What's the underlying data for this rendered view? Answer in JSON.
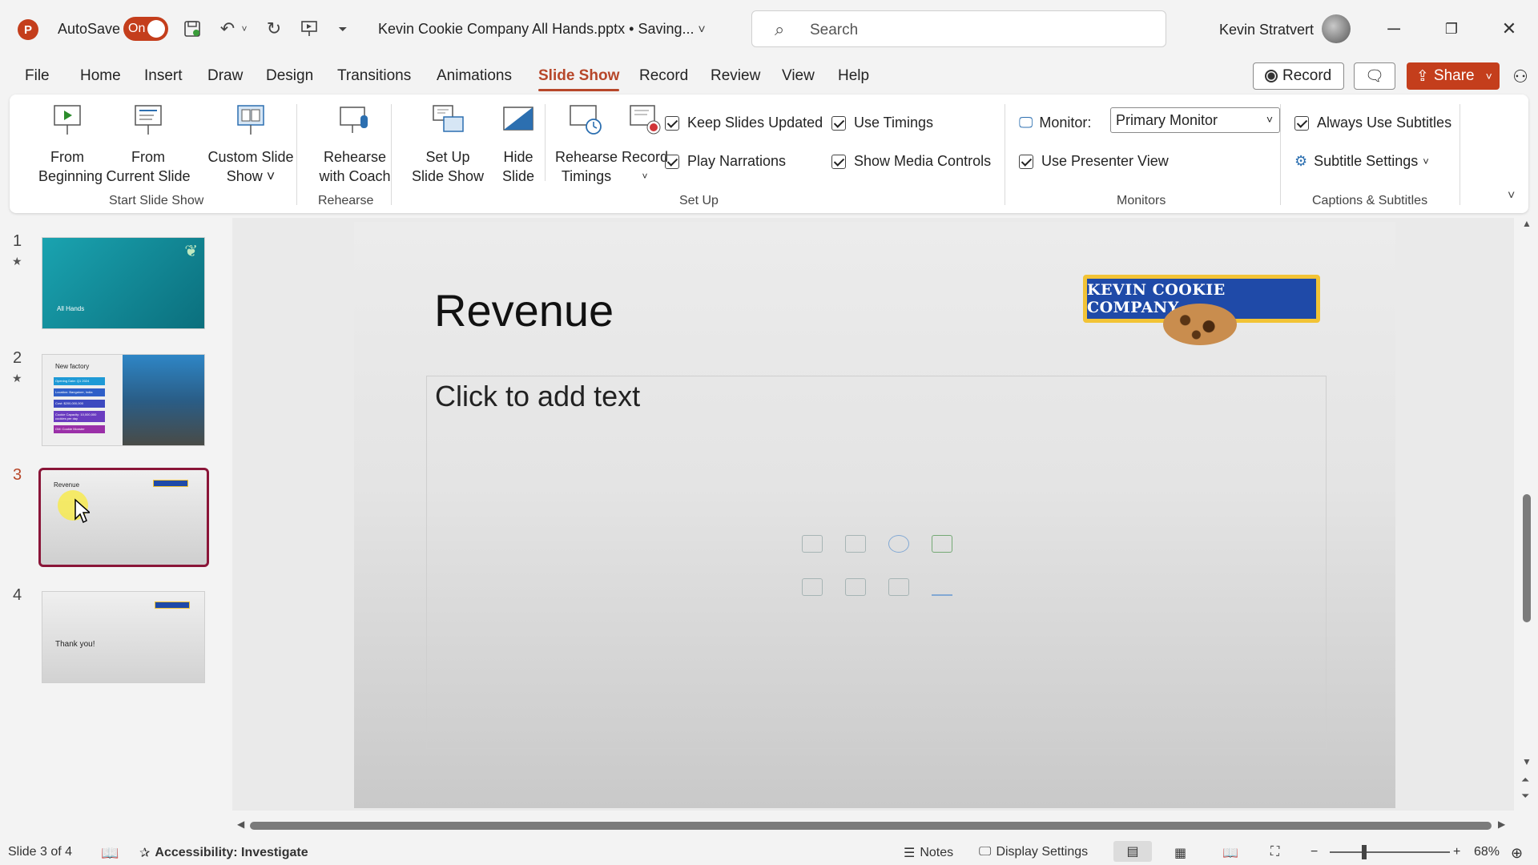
{
  "app": {
    "autosave_label": "AutoSave",
    "autosave_state": "On",
    "doc_title": "Kevin Cookie Company All Hands.pptx • Saving...",
    "search_placeholder": "Search",
    "user_name": "Kevin Stratvert",
    "accent_color": "#c43e1c"
  },
  "menu": {
    "tabs": [
      "File",
      "Home",
      "Insert",
      "Draw",
      "Design",
      "Transitions",
      "Animations",
      "Slide Show",
      "Record",
      "Review",
      "View",
      "Help"
    ],
    "active_tab": "Slide Show",
    "record_button": "Record",
    "share_button": "Share"
  },
  "ribbon": {
    "start_group": {
      "label": "Start Slide Show",
      "from_beginning": [
        "From",
        "Beginning"
      ],
      "from_current": [
        "From",
        "Current Slide"
      ],
      "custom_show": [
        "Custom Slide",
        "Show ˅"
      ]
    },
    "rehearse_group": {
      "label": "Rehearse",
      "coach": [
        "Rehearse",
        "with Coach"
      ]
    },
    "setup_group": {
      "label": "Set Up",
      "setup_show": [
        "Set Up",
        "Slide Show"
      ],
      "hide_slide": [
        "Hide",
        "Slide"
      ],
      "rehearse_timings": [
        "Rehearse",
        "Timings"
      ],
      "record": "Record",
      "keep_updated": "Keep Slides Updated",
      "use_timings": "Use Timings",
      "play_narrations": "Play Narrations",
      "show_media": "Show Media Controls"
    },
    "monitors_group": {
      "label": "Monitors",
      "monitor_label": "Monitor:",
      "monitor_value": "Primary Monitor",
      "presenter_view": "Use Presenter View"
    },
    "captions_group": {
      "label": "Captions & Subtitles",
      "always_subtitles": "Always Use Subtitles",
      "subtitle_settings": "Subtitle Settings"
    }
  },
  "thumbnails": [
    {
      "num": "1",
      "text": "All Hands"
    },
    {
      "num": "2",
      "text": "New factory",
      "bullets": [
        "Opening Date: Q1 2024",
        "Location: Bangalore, India",
        "Cost: $200,000,000",
        "Cookie Capacity: 10,000,000 cookies per day",
        "GM: Cookie Monster"
      ]
    },
    {
      "num": "3",
      "text": "Revenue"
    },
    {
      "num": "4",
      "text": "Thank you!"
    }
  ],
  "slide": {
    "title": "Revenue",
    "placeholder": "Click to add text",
    "logo_text": "KEVIN COOKIE COMPANY"
  },
  "status": {
    "slide_count": "Slide 3 of 4",
    "accessibility": "Accessibility: Investigate",
    "notes": "Notes",
    "display_settings": "Display Settings",
    "zoom": "68%"
  }
}
